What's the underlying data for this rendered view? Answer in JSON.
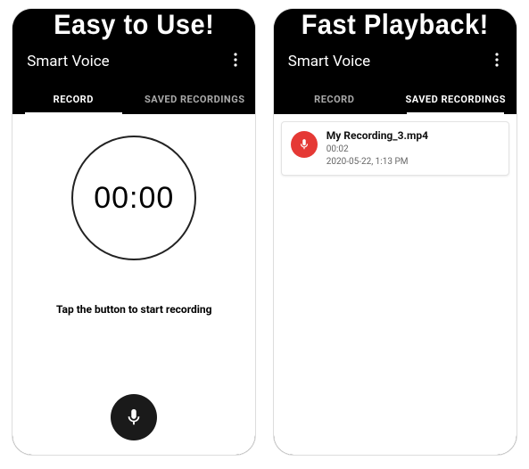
{
  "promo": {
    "left_headline": "Easy to Use!",
    "right_headline": "Fast Playback!"
  },
  "app": {
    "title": "Smart Voice"
  },
  "tabs": {
    "record": "RECORD",
    "saved": "SAVED RECORDINGS"
  },
  "record": {
    "timer": "00:00",
    "hint": "Tap the button to start recording"
  },
  "recordings": [
    {
      "title": "My Recording_3.mp4",
      "duration": "00:02",
      "timestamp": "2020-05-22, 1:13 PM"
    }
  ],
  "colors": {
    "accent_red": "#e53935",
    "text_muted": "#666666"
  }
}
